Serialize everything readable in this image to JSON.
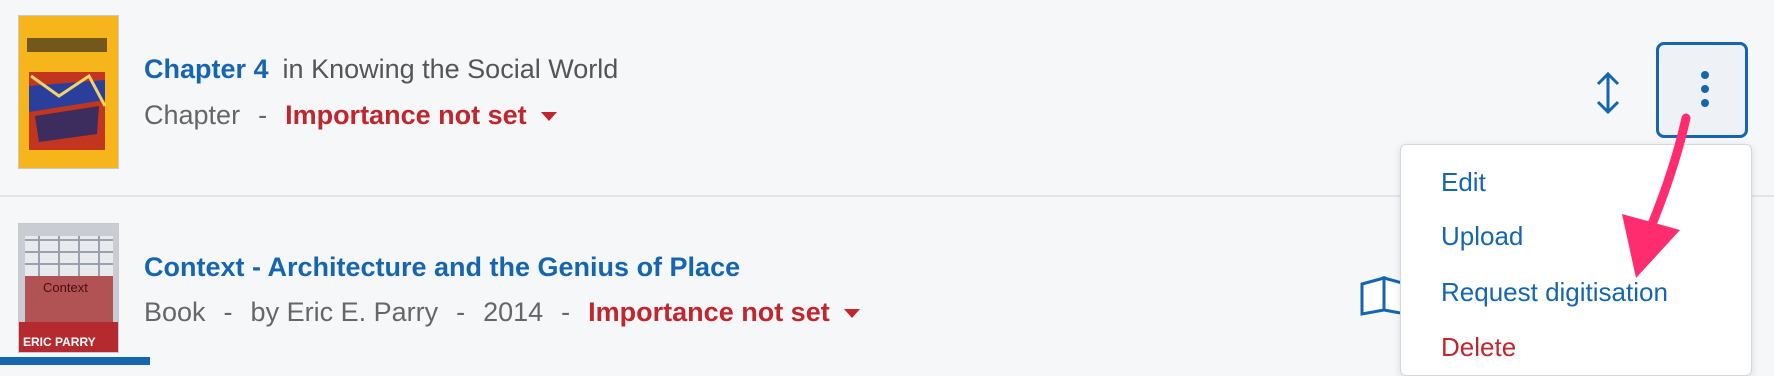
{
  "items": [
    {
      "title": "Chapter 4",
      "in_text": "in Knowing the Social World",
      "type": "Chapter",
      "separator": "-",
      "importance": "Importance not set",
      "cover_icon": "book-cover-knowing-the-social-world"
    },
    {
      "title": "Context - Architecture and the Genius of Place",
      "type": "Book",
      "separator": "-",
      "author": "by Eric E. Parry",
      "year": "2014",
      "importance": "Importance not set",
      "cover_text": "Context",
      "cover_author": "ERIC PARRY",
      "cover_icon": "book-cover-context"
    }
  ],
  "menu": {
    "items": [
      {
        "label": "Edit"
      },
      {
        "label": "Upload"
      },
      {
        "label": "Request digitisation"
      },
      {
        "label": "Delete"
      }
    ]
  },
  "colors": {
    "link": "#1565b0",
    "danger": "#c0262d",
    "annotation_arrow": "#ff2d6f"
  },
  "icons": [
    "reorder-icon",
    "more-options-icon",
    "open-book-icon",
    "annotation-arrow-icon"
  ]
}
